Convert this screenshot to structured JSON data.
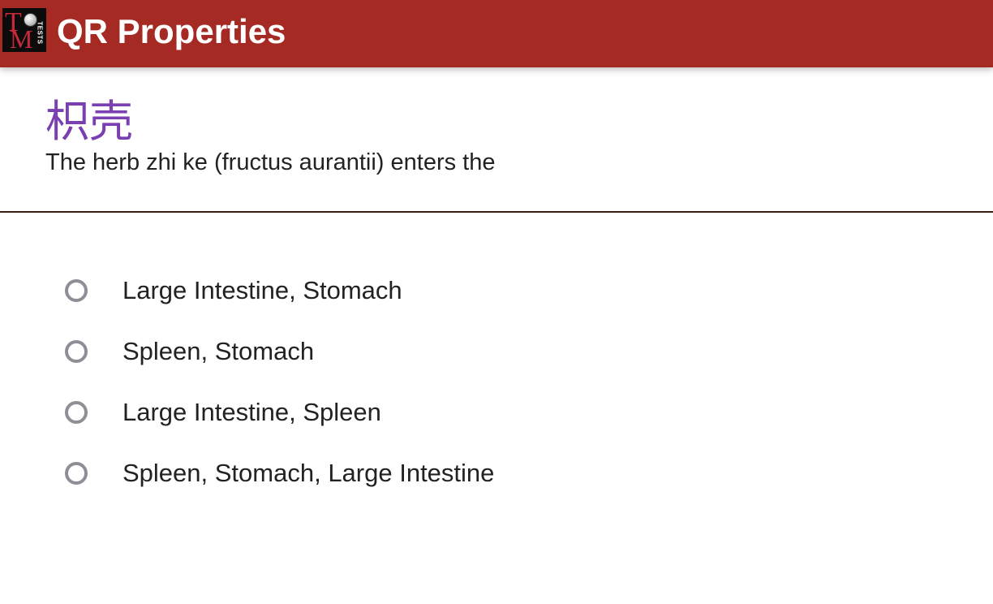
{
  "header": {
    "title": "QR Properties",
    "logo": {
      "icon": "tcm-tests-logo",
      "letters": [
        "T",
        "M"
      ],
      "tag": "TESTS"
    },
    "background_color": "#a52a24"
  },
  "question": {
    "chinese_name": "枳壳",
    "prompt": "The herb zhi ke (fructus aurantii) enters the",
    "accent_color": "#7a3fb0"
  },
  "options": [
    {
      "label": "Large Intestine, Stomach",
      "selected": false
    },
    {
      "label": "Spleen, Stomach",
      "selected": false
    },
    {
      "label": "Large Intestine, Spleen",
      "selected": false
    },
    {
      "label": "Spleen, Stomach, Large Intestine",
      "selected": false
    }
  ]
}
